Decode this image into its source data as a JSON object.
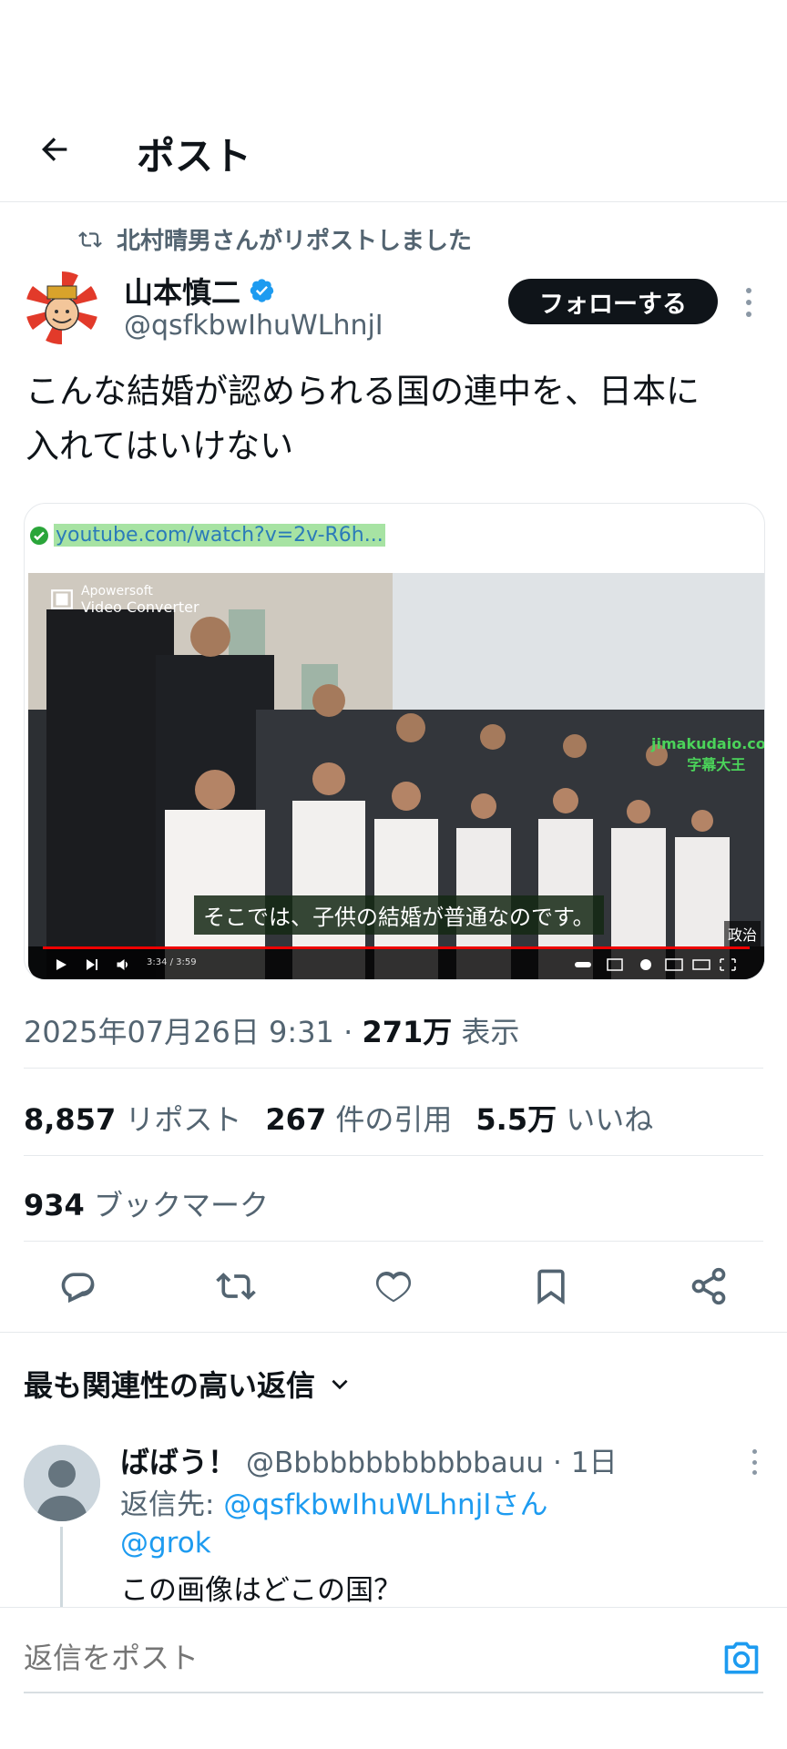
{
  "header": {
    "title": "ポスト"
  },
  "repost": {
    "text": "北村晴男さんがリポストしました"
  },
  "author": {
    "name": "山本慎二",
    "handle": "@qsfkbwIhuWLhnjI",
    "follow_label": "フォローする"
  },
  "post": {
    "text_line1": "こんな結婚が認められる国の連中を、日本に",
    "text_line2": "入れてはいけない"
  },
  "media": {
    "url": "youtube.com/watch?v=2v-R6h...",
    "subtitle": "そこでは、子供の結婚が普通なのです。",
    "watermark_top_1": "Apowersoft",
    "watermark_top_2": "Video Converter",
    "watermark_right_1": "jimakudaio.com",
    "watermark_right_2": "字幕大王",
    "tag": "政治",
    "time": "3:34 / 3:59"
  },
  "meta": {
    "datetime": "2025年07月26日 9:31",
    "sep": "·",
    "views_count": "271万",
    "views_label": "表示"
  },
  "stats": {
    "reposts_count": "8,857",
    "reposts_label": "リポスト",
    "quotes_count": "267",
    "quotes_label": "件の引用",
    "likes_count": "5.5万",
    "likes_label": "いいね",
    "bookmarks_count": "934",
    "bookmarks_label": "ブックマーク"
  },
  "sort": {
    "label": "最も関連性の高い返信"
  },
  "reply": {
    "name": "ばばう！",
    "handle": "@Bbbbbbbbbbbbauu",
    "sep": "·",
    "time": "1日",
    "reply_to_prefix": "返信先: ",
    "reply_to_handle": "@qsfkbwIhuWLhnjIさん",
    "mention": "@grok",
    "text": "この画像はどこの国？"
  },
  "compose": {
    "placeholder": "返信をポスト"
  },
  "colors": {
    "accent": "#1d9bf0",
    "text": "#0f1419",
    "muted": "#536471"
  }
}
